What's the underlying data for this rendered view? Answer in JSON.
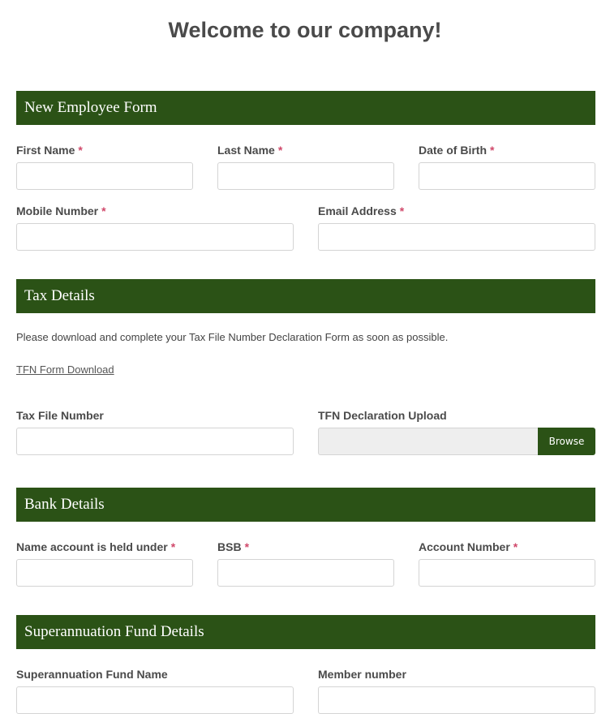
{
  "page": {
    "title": "Welcome to our company!"
  },
  "colors": {
    "header_bg": "#2b5216",
    "required_marker": "#d0486a"
  },
  "sections": {
    "employee": {
      "title": "New Employee Form",
      "fields": {
        "first_name": {
          "label": "First Name",
          "required": "*",
          "value": ""
        },
        "last_name": {
          "label": "Last Name",
          "required": "*",
          "value": ""
        },
        "dob": {
          "label": "Date of Birth",
          "required": "*",
          "value": ""
        },
        "mobile": {
          "label": "Mobile Number",
          "required": "*",
          "value": ""
        },
        "email": {
          "label": "Email Address",
          "required": "*",
          "value": ""
        }
      }
    },
    "tax": {
      "title": "Tax Details",
      "instructions": "Please download and complete your Tax File Number Declaration Form as soon as possible.",
      "download_link": "TFN Form Download",
      "fields": {
        "tfn": {
          "label": "Tax File Number",
          "value": ""
        },
        "upload": {
          "label": "TFN Declaration Upload",
          "button": "Browse"
        }
      }
    },
    "bank": {
      "title": "Bank Details",
      "fields": {
        "account_name": {
          "label": "Name account is held under",
          "required": "*",
          "value": ""
        },
        "bsb": {
          "label": "BSB",
          "required": "*",
          "value": ""
        },
        "account_number": {
          "label": "Account Number",
          "required": "*",
          "value": ""
        }
      }
    },
    "super": {
      "title": "Superannuation Fund Details",
      "fields": {
        "fund_name": {
          "label": "Superannuation Fund Name",
          "value": ""
        },
        "member_number": {
          "label": "Member number",
          "value": ""
        }
      }
    }
  }
}
